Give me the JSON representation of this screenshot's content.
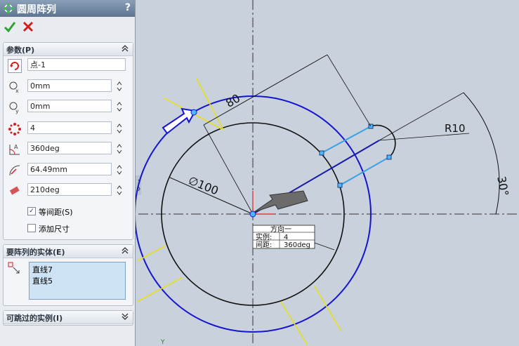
{
  "window": {
    "title": "圆周阵列",
    "help": "?"
  },
  "params": {
    "header": "参数(P)",
    "point": "点-1",
    "x": "0mm",
    "y": "0mm",
    "count": "4",
    "angle": "360deg",
    "radius": "64.49mm",
    "rotation": "210deg",
    "equal_spacing": "等间距(S)",
    "add_dimension": "添加尺寸"
  },
  "entities": {
    "header": "要阵列的实体(E)",
    "items": [
      "直线7",
      "直线5"
    ]
  },
  "skip": {
    "header": "可跳过的实例(I)"
  },
  "sketch": {
    "dim_80": "80",
    "dim_d100": "∅100",
    "dim_r10": "R10",
    "dim_30": "30°",
    "callout_title": "方向一",
    "callout_count_label": "实例:",
    "callout_count_value": "4",
    "callout_spacing_label": "间距:",
    "callout_spacing_value": "360deg",
    "axis_y": "Y"
  }
}
